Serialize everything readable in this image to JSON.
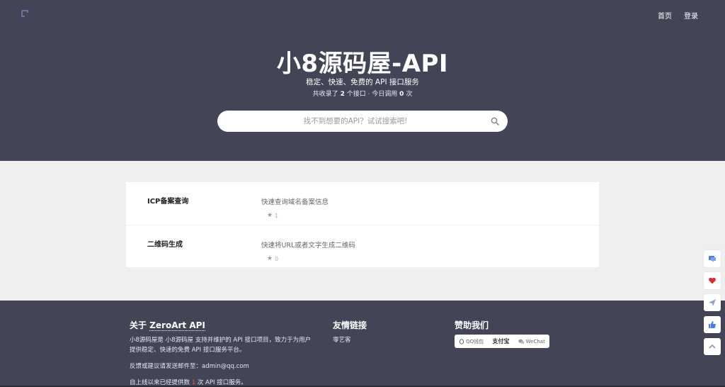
{
  "header": {
    "nav": {
      "home": "首页",
      "login": "登录"
    },
    "title": "小8源码屋-API",
    "tagline": "稳定、快速、免费的 API 接口服务",
    "stats": {
      "prefix": "共收录了",
      "api_count": "2",
      "mid": "个接口 · 今日调用",
      "call_count": "0",
      "suffix": "次"
    }
  },
  "search": {
    "placeholder": "找不到想要的API？试试搜索吧!"
  },
  "apis": [
    {
      "name": "ICP备案查询",
      "description": "快速查询域名备案信息",
      "stars": "1"
    },
    {
      "name": "二维码生成",
      "description": "快速将URL或者文字生成二维码",
      "stars": "0"
    }
  ],
  "footer": {
    "about": {
      "heading_prefix": "关于",
      "heading_name": "ZeroArt API",
      "text1": "小8源码屋是 小8源码屋 支持并维护的 API 接口项目，致力于为用户提供稳定、快速的免费 API 接口服务平台。",
      "text2": "反馈或建议请发送邮件至：admin@qq.com",
      "text3_prefix": "自上线以来已经提供数",
      "text3_count": "1",
      "text3_suffix": "次 API 接口服务。"
    },
    "links": {
      "heading": "友情链接",
      "items": [
        "零艺客"
      ]
    },
    "donate": {
      "heading": "赞助我们",
      "qq": "QQ钱包",
      "alipay": "支付宝",
      "wechat": "WeChat"
    }
  },
  "colors": {
    "header_bg": "#434557",
    "page_bg": "#efeff1",
    "accent_blue": "#4a7de8",
    "heart_red": "#e0292b"
  },
  "side_tools": [
    "chat-icon",
    "heart-icon",
    "send-icon",
    "thumbs-up-icon",
    "chevron-up-icon"
  ]
}
